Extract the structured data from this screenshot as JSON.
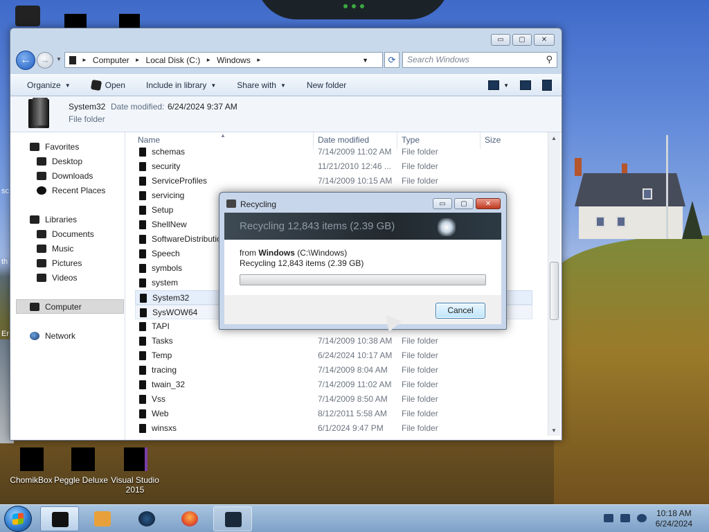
{
  "desktop": {
    "icons": [
      {
        "label": "ChomikBox"
      },
      {
        "label": "Peggle Deluxe"
      },
      {
        "label": "Visual Studio 2015"
      }
    ],
    "partial_labels": [
      "sc",
      "th",
      "Er"
    ]
  },
  "explorer": {
    "controls": {
      "minimize": "▭",
      "maximize": "▢",
      "close": "✕"
    },
    "nav": {
      "back": "←",
      "forward": "→",
      "history_caret": "▼"
    },
    "address": {
      "segments": [
        "Computer",
        "Local Disk (C:)",
        "Windows"
      ],
      "separator": "►",
      "dropdown": "▼",
      "refresh": "⟳"
    },
    "search": {
      "placeholder": "Search Windows",
      "icon": "⚲"
    },
    "toolbar": {
      "organize": "Organize",
      "open": "Open",
      "include_in_library": "Include in library",
      "share_with": "Share with",
      "new_folder": "New folder"
    },
    "details": {
      "name": "System32",
      "modified_label": "Date modified:",
      "modified_value": "6/24/2024 9:37 AM",
      "type": "File folder"
    },
    "navigation": {
      "favorites": "Favorites",
      "desktop": "Desktop",
      "downloads": "Downloads",
      "recent_places": "Recent Places",
      "libraries": "Libraries",
      "documents": "Documents",
      "music": "Music",
      "pictures": "Pictures",
      "videos": "Videos",
      "computer": "Computer",
      "network": "Network"
    },
    "columns": {
      "name": "Name",
      "date_modified": "Date modified",
      "type": "Type",
      "size": "Size"
    },
    "rows": [
      {
        "name": "schemas",
        "date": "7/14/2009 11:02 AM",
        "type": "File folder"
      },
      {
        "name": "security",
        "date": "11/21/2010 12:46 ...",
        "type": "File folder"
      },
      {
        "name": "ServiceProfiles",
        "date": "7/14/2009 10:15 AM",
        "type": "File folder"
      },
      {
        "name": "servicing",
        "date": "",
        "type": ""
      },
      {
        "name": "Setup",
        "date": "",
        "type": ""
      },
      {
        "name": "ShellNew",
        "date": "",
        "type": ""
      },
      {
        "name": "SoftwareDistributio",
        "date": "",
        "type": ""
      },
      {
        "name": "Speech",
        "date": "",
        "type": ""
      },
      {
        "name": "symbols",
        "date": "",
        "type": ""
      },
      {
        "name": "system",
        "date": "",
        "type": ""
      },
      {
        "name": "System32",
        "date": "",
        "type": ""
      },
      {
        "name": "SysWOW64",
        "date": "",
        "type": ""
      },
      {
        "name": "TAPI",
        "date": "",
        "type": ""
      },
      {
        "name": "Tasks",
        "date": "7/14/2009 10:38 AM",
        "type": "File folder"
      },
      {
        "name": "Temp",
        "date": "6/24/2024 10:17 AM",
        "type": "File folder"
      },
      {
        "name": "tracing",
        "date": "7/14/2009 8:04 AM",
        "type": "File folder"
      },
      {
        "name": "twain_32",
        "date": "7/14/2009 11:02 AM",
        "type": "File folder"
      },
      {
        "name": "Vss",
        "date": "7/14/2009 8:50 AM",
        "type": "File folder"
      },
      {
        "name": "Web",
        "date": "8/12/2011 5:58 AM",
        "type": "File folder"
      },
      {
        "name": "winsxs",
        "date": "6/1/2024 9:47 PM",
        "type": "File folder"
      }
    ]
  },
  "dialog": {
    "title": "Recycling",
    "header": "Recycling 12,843 items (2.39 GB)",
    "from_prefix": "from ",
    "from_name": "Windows",
    "from_path": " (C:\\Windows)",
    "subline": "Recycling 12,843 items (2.39 GB)",
    "progress": 0,
    "cancel": "Cancel",
    "controls": {
      "minimize": "▭",
      "maximize": "▢",
      "close": "✕"
    }
  },
  "taskbar": {
    "clock_time": "10:18 AM",
    "clock_date": "6/24/2024"
  }
}
